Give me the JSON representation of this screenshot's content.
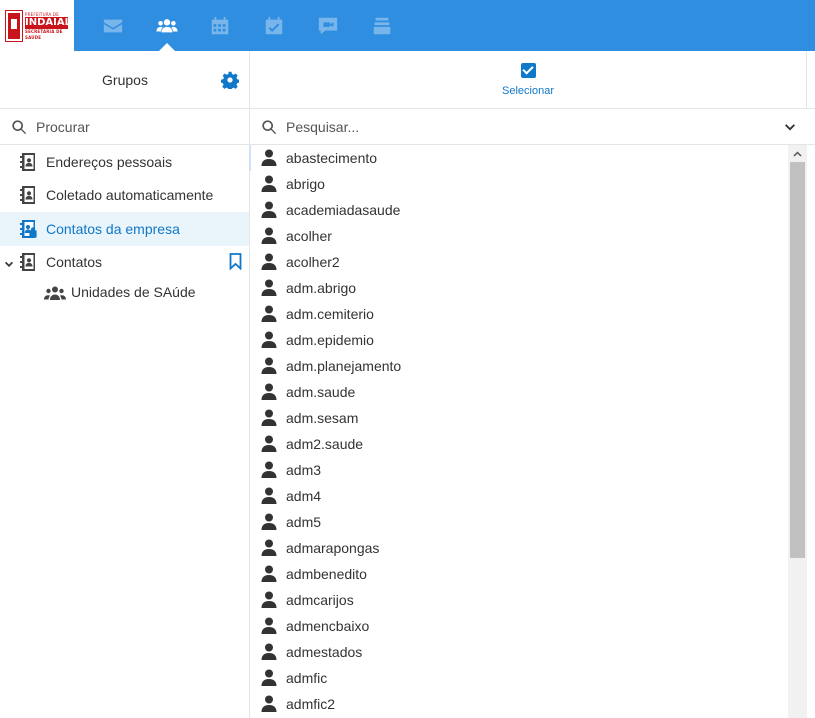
{
  "app": {
    "logo": {
      "line1": "PREFEITURA DE",
      "line2": "INDAIAL",
      "line3": "SECRETARIA DE SAÚDE"
    },
    "nav": [
      {
        "name": "mail-icon",
        "active": false
      },
      {
        "name": "contacts-icon",
        "active": true
      },
      {
        "name": "calendar-icon",
        "active": false
      },
      {
        "name": "tasks-icon",
        "active": false
      },
      {
        "name": "chat-icon",
        "active": false
      },
      {
        "name": "files-icon",
        "active": false
      }
    ],
    "accent_color": "#2f8ee0"
  },
  "left": {
    "title": "Grupos",
    "search_placeholder": "Procurar",
    "folders": [
      {
        "label": "Endereços pessoais",
        "selected": false
      },
      {
        "label": "Coletado automaticamente",
        "selected": false
      },
      {
        "label": "Contatos da empresa",
        "selected": true
      },
      {
        "label": "Contatos",
        "selected": false,
        "expanded": true
      }
    ],
    "group": {
      "label": "Unidades de SAúde"
    }
  },
  "right": {
    "select_label": "Selecionar",
    "search_placeholder": "Pesquisar...",
    "contacts": [
      "abastecimento",
      "abrigo",
      "academiadasaude",
      "acolher",
      "acolher2",
      "adm.abrigo",
      "adm.cemiterio",
      "adm.epidemio",
      "adm.planejamento",
      "adm.saude",
      "adm.sesam",
      "adm2.saude",
      "adm3",
      "adm4",
      "adm5",
      "admarapongas",
      "admbenedito",
      "admcarijos",
      "admencbaixo",
      "admestados",
      "admfic",
      "admfic2"
    ]
  }
}
